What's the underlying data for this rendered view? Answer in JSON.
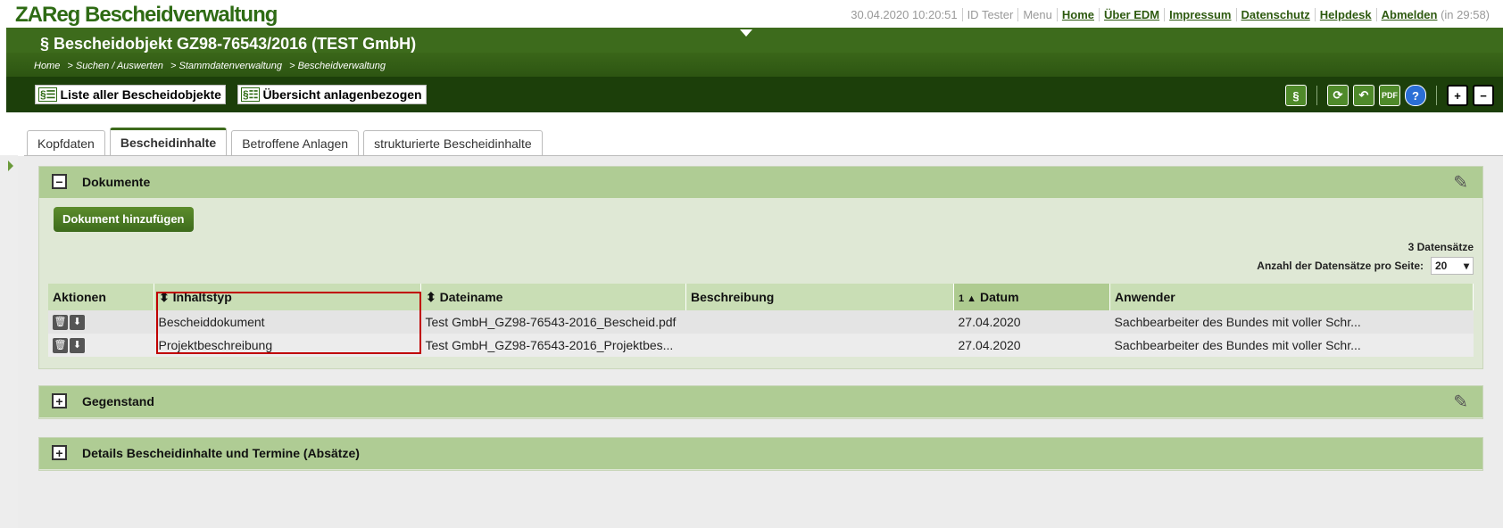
{
  "app": {
    "title": "ZAReg Bescheidverwaltung"
  },
  "topnav": {
    "timestamp": "30.04.2020 10:20:51",
    "user": "ID Tester",
    "menu": "Menu",
    "links": [
      "Home",
      "Über EDM",
      "Impressum",
      "Datenschutz",
      "Helpdesk",
      "Abmelden"
    ],
    "session": "(in 29:58)"
  },
  "header": {
    "title": "§ Bescheidobjekt GZ98-76543/2016 (TEST GmbH)",
    "breadcrumb": [
      "Home",
      "> Suchen / Auswerten",
      "> Stammdatenverwaltung",
      "> Bescheidverwaltung"
    ]
  },
  "toolbar": {
    "list_all": "Liste aller Bescheidobjekte",
    "list_all_icon": "§☰",
    "overview": "Übersicht anlagenbezogen",
    "overview_icon": "§☷",
    "right_icons": [
      "paragraph-add-icon",
      "refresh-icon",
      "undo-icon",
      "pdf-icon",
      "help-icon",
      "expand-all-icon",
      "collapse-all-icon"
    ]
  },
  "tabs": [
    "Kopfdaten",
    "Bescheidinhalte",
    "Betroffene Anlagen",
    "strukturierte Bescheidinhalte"
  ],
  "active_tab": "Bescheidinhalte",
  "documents": {
    "title": "Dokumente",
    "add_button": "Dokument hinzufügen",
    "record_count": "3 Datensätze",
    "per_page_label": "Anzahl der Datensätze pro Seite:",
    "per_page_value": "20",
    "columns": [
      "Aktionen",
      "Inhaltstyp",
      "Dateiname",
      "Beschreibung",
      "Datum",
      "Anwender"
    ],
    "column_prefix": {
      "inhaltstyp": "⬍",
      "dateiname": "⬍",
      "datum": "1 ▲"
    },
    "rows": [
      {
        "inhaltstyp": "Bescheiddokument",
        "dateiname": "Test GmbH_GZ98-76543-2016_Bescheid.pdf",
        "beschreibung": "",
        "datum": "27.04.2020",
        "anwender": "Sachbearbeiter des Bundes mit voller Schr..."
      },
      {
        "inhaltstyp": "Projektbeschreibung",
        "dateiname": "Test GmbH_GZ98-76543-2016_Projektbes...",
        "beschreibung": "",
        "datum": "27.04.2020",
        "anwender": "Sachbearbeiter des Bundes mit voller Schr..."
      }
    ]
  },
  "panels": [
    {
      "title": "Gegenstand"
    },
    {
      "title": "Details Bescheidinhalte und Termine (Absätze)"
    }
  ],
  "colors": {
    "brand": "#2e6b14",
    "header": "#3d6b1c",
    "toolbar": "#1c3f0a",
    "panel_head": "#afcc94",
    "highlight": "#c00000"
  }
}
